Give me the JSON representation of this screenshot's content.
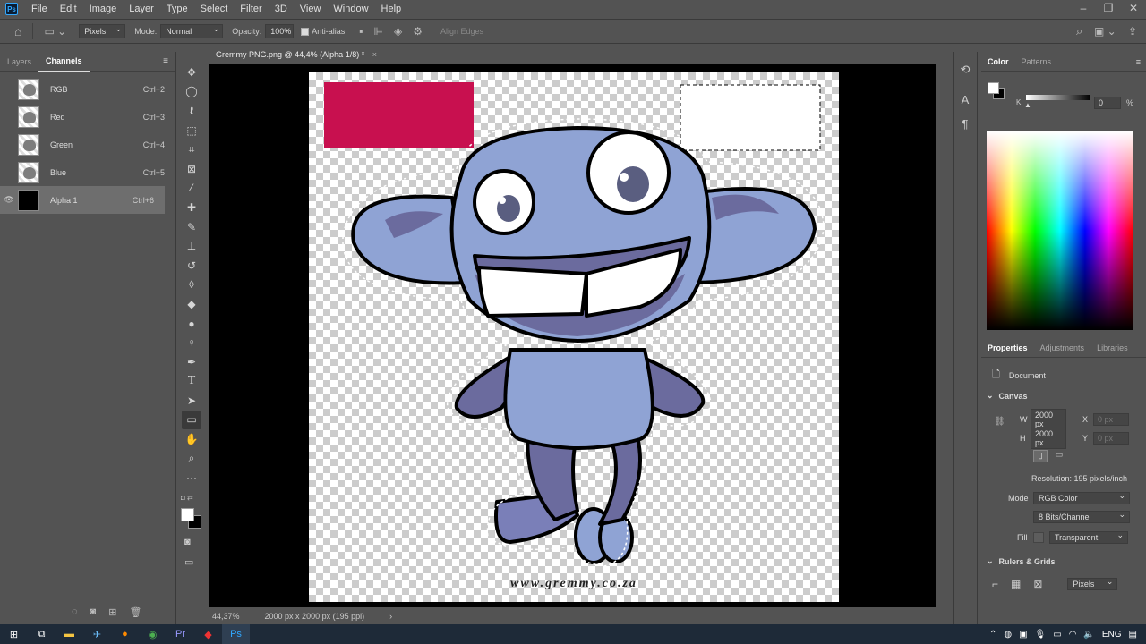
{
  "app": {
    "menu": [
      "File",
      "Edit",
      "Image",
      "Layer",
      "Type",
      "Select",
      "Filter",
      "3D",
      "View",
      "Window",
      "Help"
    ],
    "logo": "Ps"
  },
  "options_bar": {
    "units": "Pixels",
    "mode_label": "Mode:",
    "mode_value": "Normal",
    "opacity_label": "Opacity:",
    "opacity_value": "100%",
    "antialias_label": "Anti-alias",
    "align_edges": "Align Edges"
  },
  "left_panel": {
    "tabs": [
      "Layers",
      "Channels"
    ],
    "active_tab": "Channels",
    "channels": [
      {
        "name": "RGB",
        "shortcut": "Ctrl+2"
      },
      {
        "name": "Red",
        "shortcut": "Ctrl+3"
      },
      {
        "name": "Green",
        "shortcut": "Ctrl+4"
      },
      {
        "name": "Blue",
        "shortcut": "Ctrl+5"
      },
      {
        "name": "Alpha 1",
        "shortcut": "Ctrl+6"
      }
    ]
  },
  "document": {
    "tab_title": "Gremmy PNG.png @ 44,4% (Alpha 1/8) *",
    "zoom": "44,37%",
    "size_info": "2000 px x 2000 px (195 ppi)",
    "watermark": "www.gremmy.co.za"
  },
  "color_panel": {
    "tabs": [
      "Color",
      "Patterns"
    ],
    "k_label": "K",
    "k_value": "0",
    "k_unit": "%"
  },
  "properties": {
    "tabs": [
      "Properties",
      "Adjustments",
      "Libraries"
    ],
    "document_label": "Document",
    "canvas_label": "Canvas",
    "w_label": "W",
    "w_value": "2000 px",
    "h_label": "H",
    "h_value": "2000 px",
    "x_label": "X",
    "x_value": "0 px",
    "y_label": "Y",
    "y_value": "0 px",
    "resolution": "Resolution: 195 pixels/inch",
    "mode_label": "Mode",
    "mode_value": "RGB Color",
    "depth_value": "8 Bits/Channel",
    "fill_label": "Fill",
    "fill_value": "Transparent",
    "rulers_label": "Rulers & Grids",
    "rulers_unit": "Pixels"
  },
  "taskbar": {
    "lang": "ENG"
  },
  "colors": {
    "ui_bg": "#535353",
    "rect_magenta": "#c8104f",
    "char_light": "#8fa3d4",
    "char_dark": "#6b6b9e",
    "char_mid": "#7a7fb8"
  }
}
